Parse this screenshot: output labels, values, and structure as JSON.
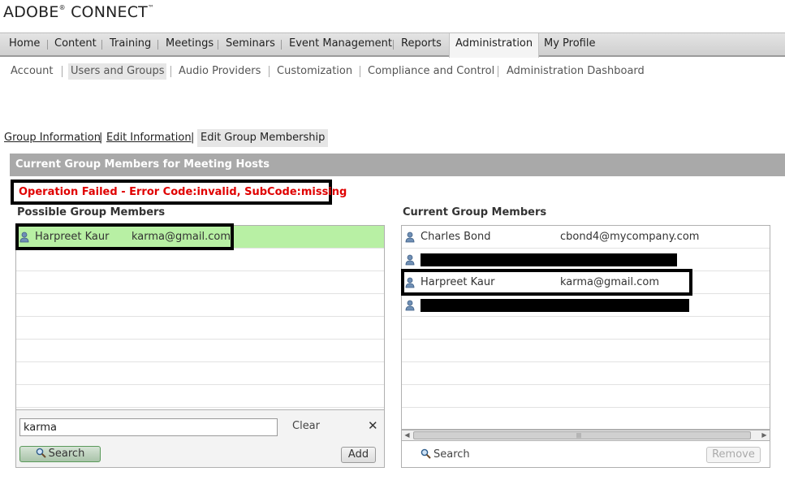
{
  "logo": {
    "brand": "ADOBE",
    "reg": "®",
    "product": " CONNECT",
    "tm": "™"
  },
  "nav": [
    "Home",
    "Content",
    "Training",
    "Meetings",
    "Seminars",
    "Event Management",
    "Reports",
    "Administration",
    "My Profile"
  ],
  "nav_active": "Administration",
  "subnav": [
    "Account",
    "Users and Groups",
    "Audio Providers",
    "Customization",
    "Compliance and Control",
    "Administration Dashboard"
  ],
  "subnav_active": "Users and Groups",
  "tabs": [
    "Group Information",
    "Edit Information",
    "Edit Group Membership"
  ],
  "tab_separator": "|",
  "panel_title": "Current Group Members for Meeting Hosts",
  "error_message": "Operation Failed  - Error Code:invalid, SubCode:missing",
  "possible": {
    "title": "Possible Group Members",
    "members": [
      {
        "name": "Harpreet Kaur",
        "email": "karma@gmail.com"
      }
    ],
    "search_value": "karma",
    "clear_label": "Clear",
    "close_glyph": "✕",
    "search_label": "Search",
    "add_label": "Add"
  },
  "current": {
    "title": "Current Group Members",
    "members": [
      {
        "name": "Charles Bond",
        "email": "cbond4@mycompany.com"
      },
      {
        "name": "Harpreet Kaur",
        "email": "karma@gmail.com"
      }
    ],
    "search_label": "Search",
    "remove_label": "Remove"
  },
  "icons": {
    "user": "user-icon",
    "search": "magnifier-icon",
    "close": "close-icon"
  },
  "colors": {
    "error": "#e00000",
    "selected_row": "#b8f0a4",
    "header_bar": "#a9a9a9"
  }
}
